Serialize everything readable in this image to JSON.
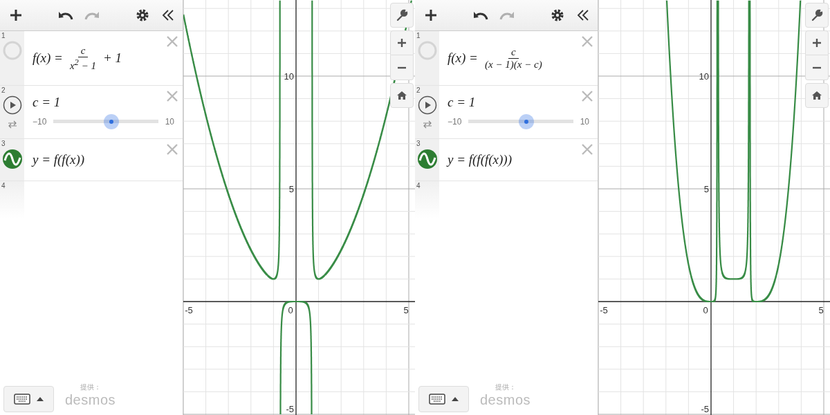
{
  "calculators": [
    {
      "toolbar": {
        "redo": {
          "disabled": true
        }
      },
      "expressions": [
        {
          "number": "1",
          "kind": "function",
          "lhs": "f(x) =",
          "numerator": "c",
          "denominator": "x$^{2}$ − 1",
          "suffix": "+ 1"
        },
        {
          "number": "2",
          "kind": "slider",
          "text": "c = 1",
          "min": "−10",
          "max": "10",
          "level": 0.55
        },
        {
          "number": "3",
          "kind": "plain",
          "text": "y = f(f(x))"
        },
        {
          "number": "4",
          "kind": "empty"
        }
      ],
      "graph": {
        "x_labels": [
          "-5",
          "0",
          "5"
        ],
        "y_labels": [
          "10",
          "5",
          "-5"
        ]
      },
      "footer": {
        "credit": "提供：",
        "logo": "desmos"
      }
    },
    {
      "toolbar": {
        "redo": {
          "disabled": true
        }
      },
      "expressions": [
        {
          "number": "1",
          "kind": "function",
          "lhs": "f(x) =",
          "numerator": "c",
          "denominator": "(x − 1)(x − c)"
        },
        {
          "number": "2",
          "kind": "slider",
          "text": "c = 1",
          "min": "−10",
          "max": "10",
          "level": 0.55
        },
        {
          "number": "3",
          "kind": "plain",
          "text": "y = f(f(f(x)))"
        },
        {
          "number": "4",
          "kind": "empty"
        }
      ],
      "graph": {
        "x_labels": [
          "-5",
          "0",
          "5"
        ],
        "y_labels": [
          "10",
          "5",
          "-5"
        ]
      },
      "footer": {
        "credit": "提供：",
        "logo": "desmos"
      }
    }
  ]
}
